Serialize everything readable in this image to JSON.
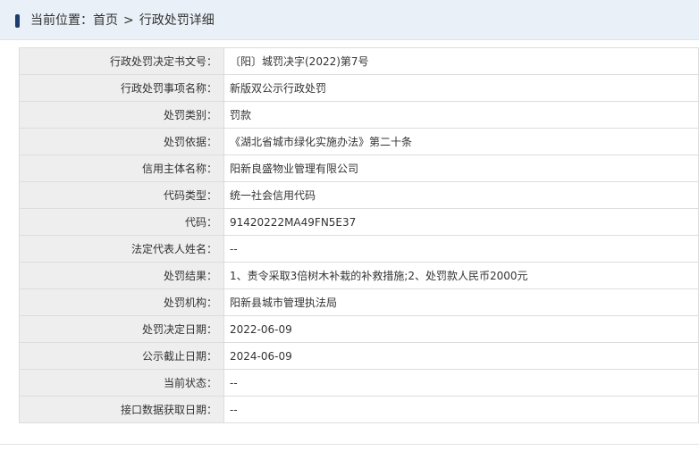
{
  "breadcrumb": {
    "prefix": "当前位置：",
    "home": "首页",
    "separator": ">",
    "current": "行政处罚详细"
  },
  "rows": [
    {
      "label": "行政处罚决定书文号：",
      "value": "〔阳〕城罚决字(2022)第7号"
    },
    {
      "label": "行政处罚事项名称：",
      "value": "新版双公示行政处罚"
    },
    {
      "label": "处罚类别：",
      "value": "罚款"
    },
    {
      "label": "处罚依据：",
      "value": "《湖北省城市绿化实施办法》第二十条"
    },
    {
      "label": "信用主体名称：",
      "value": "阳新良盛物业管理有限公司"
    },
    {
      "label": "代码类型：",
      "value": "统一社会信用代码"
    },
    {
      "label": "代码：",
      "value": "91420222MA49FN5E37"
    },
    {
      "label": "法定代表人姓名：",
      "value": "--"
    },
    {
      "label": "处罚结果：",
      "value": "1、责令采取3倍树木补栽的补救措施;2、处罚款人民币2000元"
    },
    {
      "label": "处罚机构：",
      "value": "阳新县城市管理执法局"
    },
    {
      "label": "处罚决定日期：",
      "value": "2022-06-09"
    },
    {
      "label": "公示截止日期：",
      "value": "2024-06-09"
    },
    {
      "label": "当前状态：",
      "value": "--"
    },
    {
      "label": "接口数据获取日期：",
      "value": "--"
    }
  ]
}
